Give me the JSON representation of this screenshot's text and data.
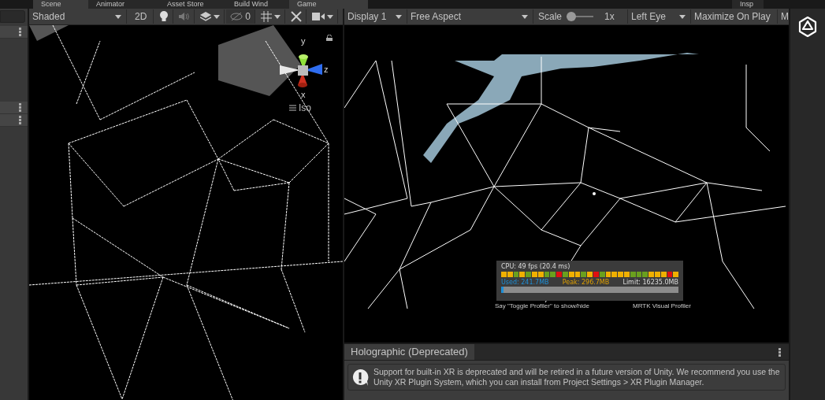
{
  "panel_tabs": [
    "Scene",
    "Animator",
    "Asset Store",
    "Build Wind",
    "Game",
    "Insp"
  ],
  "scene": {
    "toolbar": {
      "shading": "Shaded",
      "mode_2d": "2D",
      "hidden_count": "0"
    },
    "gizmo": {
      "axes": [
        "y",
        "z",
        "x"
      ],
      "projection": "Iso"
    }
  },
  "game": {
    "toolbar": {
      "display": "Display 1",
      "aspect": "Free Aspect",
      "scale_label": "Scale",
      "scale": {
        "level": 0
      },
      "scale_value": "1x",
      "eye": "Left Eye",
      "maximize": "Maximize On Play",
      "cut_button": "M"
    },
    "profiler": {
      "cpu": "CPU: 49 fps (20.4 ms)",
      "used": "Used: 241.7MB",
      "peak": "Peak: 296.7MB",
      "limit": "Limit: 16235.0MB",
      "memory": {
        "level": 0.015
      }
    },
    "hints": [
      "Say \"Toggle Profiler\" to show/hide",
      "MRTK Visual Profiler"
    ]
  },
  "holographic": {
    "tab": "Holographic (Deprecated)",
    "message": "Support for built-in XR is deprecated and will be retired in a future version of Unity. We recommend you use the Unity XR Plugin System, which you can install from Project Settings > XR Plugin Manager."
  }
}
